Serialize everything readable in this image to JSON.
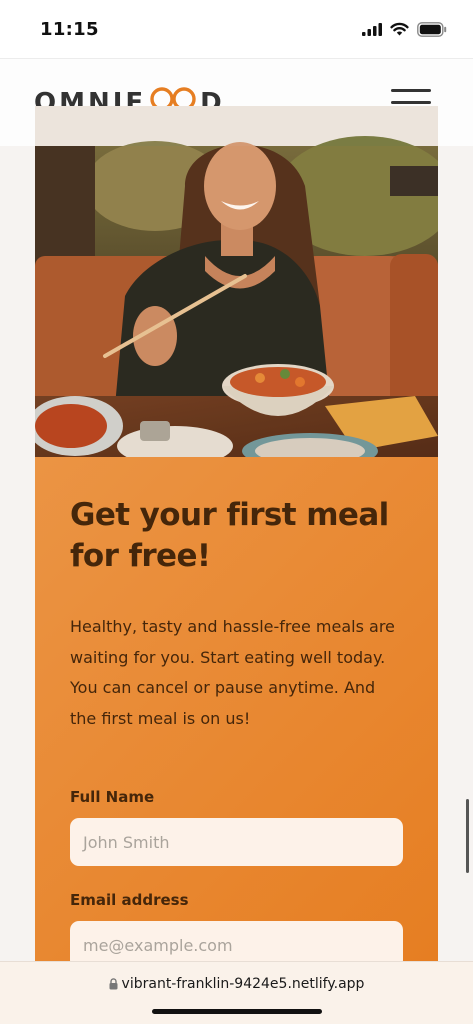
{
  "status_bar": {
    "time": "11:15"
  },
  "header": {
    "logo_left": "OMNIF",
    "logo_right": "D",
    "logo_mark_icon": "intertwined-rings-icon",
    "accent_color": "#e67e22"
  },
  "cta": {
    "title": "Get your first meal for free!",
    "text": "Healthy, tasty and hassle-free meals are waiting for you. Start eating well today. You can cancel or pause anytime. And the first meal is on us!",
    "form": {
      "name_label": "Full Name",
      "name_placeholder": "John Smith",
      "email_label": "Email address",
      "email_placeholder": "me@example.com"
    },
    "colors": {
      "bg_start": "#eb9444",
      "bg_end": "#e67e22",
      "text": "#45260a",
      "input_bg": "#fdf2e9"
    }
  },
  "browser": {
    "url": "vibrant-franklin-9424e5.netlify.app",
    "lock_icon": "lock-icon"
  }
}
